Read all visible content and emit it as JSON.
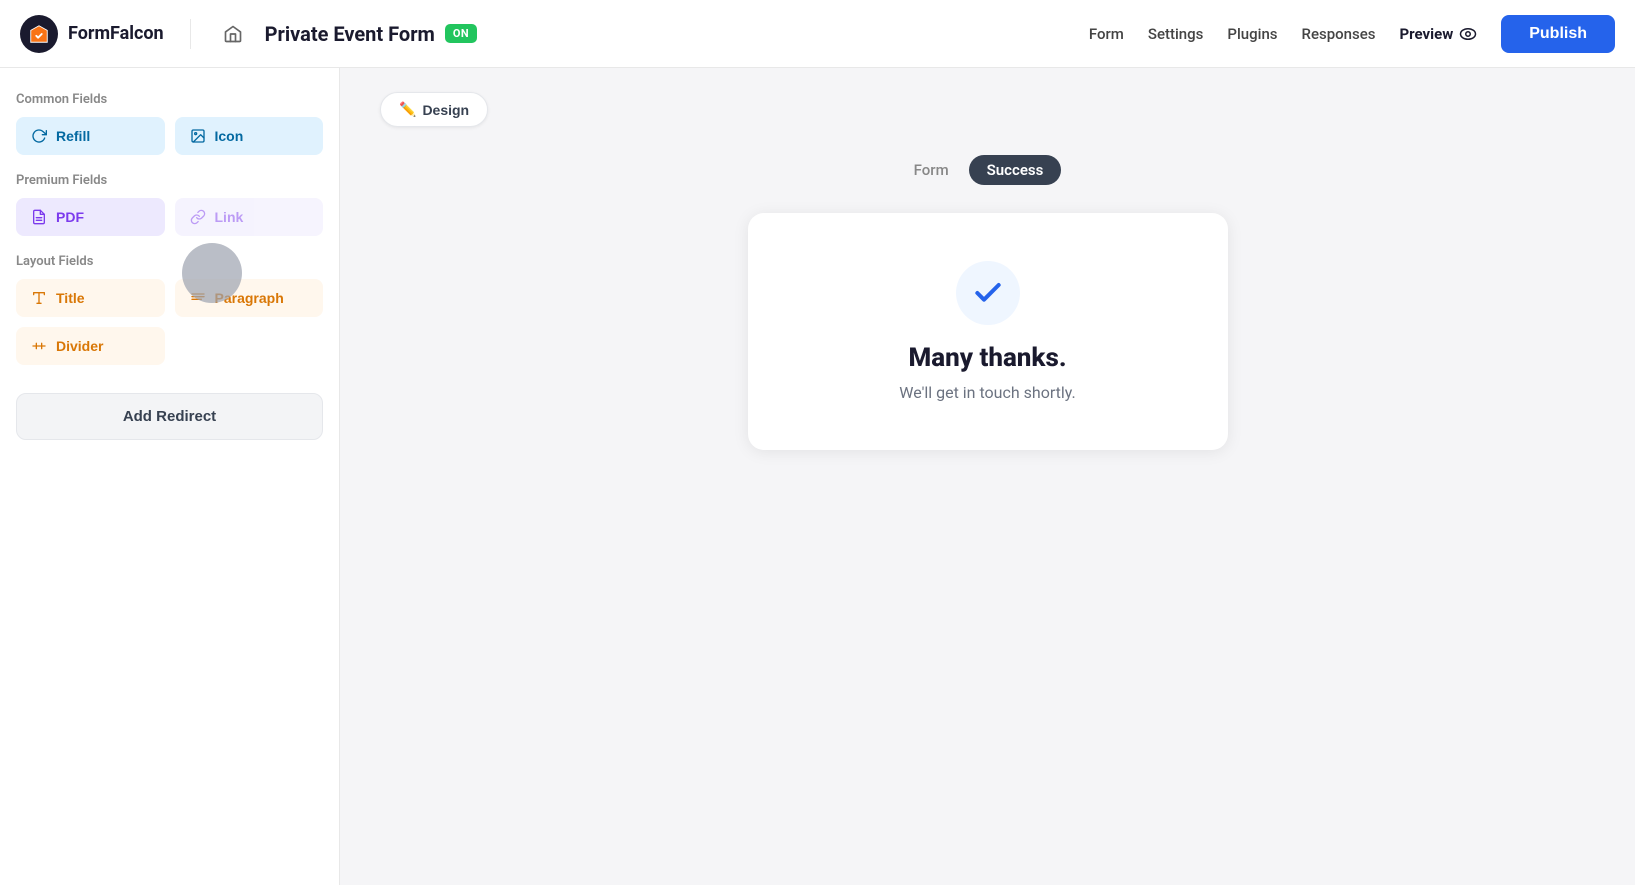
{
  "header": {
    "logo_text": "FormFalcon",
    "form_title": "Private Event Form",
    "on_badge": "ON",
    "home_icon": "🏠",
    "nav_links": [
      "Form",
      "Settings",
      "Plugins",
      "Responses"
    ],
    "preview_label": "Preview",
    "publish_label": "Publish"
  },
  "sidebar": {
    "common_fields_label": "Common Fields",
    "premium_fields_label": "Premium Fields",
    "layout_fields_label": "Layout Fields",
    "fields_common": [
      {
        "label": "Refill",
        "type": "blue"
      },
      {
        "label": "Icon",
        "type": "blue"
      }
    ],
    "fields_premium": [
      {
        "label": "PDF",
        "type": "purple"
      },
      {
        "label": "Link",
        "type": "purple"
      }
    ],
    "fields_layout": [
      {
        "label": "Title",
        "type": "orange"
      },
      {
        "label": "Paragraph",
        "type": "orange"
      },
      {
        "label": "Divider",
        "type": "orange"
      }
    ],
    "add_redirect_label": "Add Redirect"
  },
  "content": {
    "design_tab_label": "Design",
    "design_tab_icon": "✏️",
    "tab_form_label": "Form",
    "tab_success_label": "Success",
    "success_title": "Many thanks.",
    "success_subtitle": "We'll get in touch shortly."
  }
}
